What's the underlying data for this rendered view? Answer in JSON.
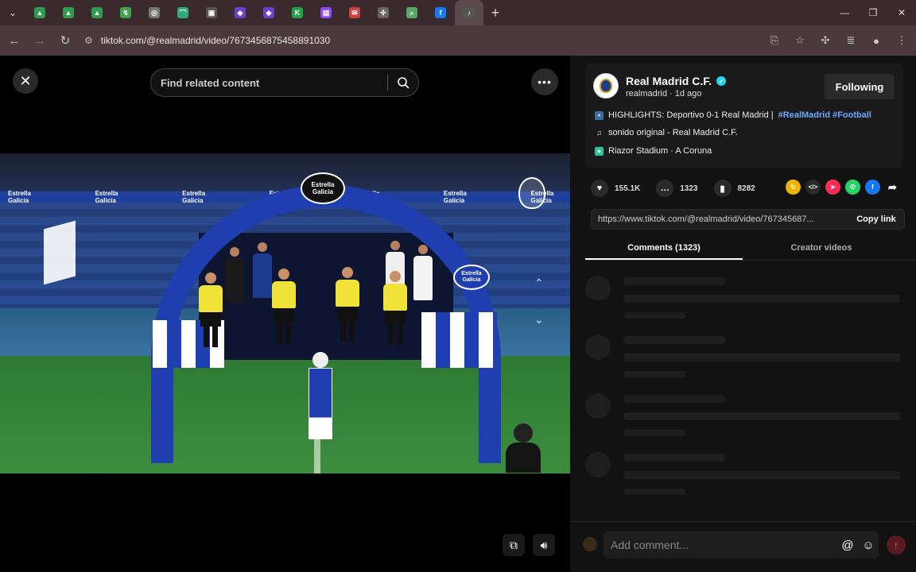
{
  "browser": {
    "url": "tiktok.com/@realmadrid/video/7673456875458891030",
    "tabs": [
      {
        "icon": "drive-icon",
        "color": "#2e9d4f",
        "glyph": "▲"
      },
      {
        "icon": "drive-icon",
        "color": "#2e9d4f",
        "glyph": "▲"
      },
      {
        "icon": "drive-icon",
        "color": "#2e9d4f",
        "glyph": "▲"
      },
      {
        "icon": "extension-icon",
        "color": "#3fa34d",
        "glyph": "↯"
      },
      {
        "icon": "globe-icon",
        "color": "#777",
        "glyph": "◎"
      },
      {
        "icon": "app-icon",
        "color": "#3a7",
        "glyph": "⌒"
      },
      {
        "icon": "window-icon",
        "color": "#555",
        "glyph": "▣"
      },
      {
        "icon": "app-icon",
        "color": "#6b3fd0",
        "glyph": "◆"
      },
      {
        "icon": "app-icon",
        "color": "#6b3fd0",
        "glyph": "◆"
      },
      {
        "icon": "k-icon",
        "color": "#1fa34a",
        "glyph": "K"
      },
      {
        "icon": "twitch-icon",
        "color": "#9146ff",
        "glyph": "▤"
      },
      {
        "icon": "mail-icon",
        "color": "#d04040",
        "glyph": "✉"
      },
      {
        "icon": "puzzle-icon",
        "color": "#666",
        "glyph": "✣"
      },
      {
        "icon": "search-icon",
        "color": "#5a6",
        "glyph": "⌕"
      },
      {
        "icon": "facebook-icon",
        "color": "#1877f2",
        "glyph": "f"
      },
      {
        "icon": "audio-icon",
        "color": "#555",
        "glyph": "♪"
      }
    ]
  },
  "video": {
    "search_placeholder": "Find related content",
    "banner_text": "Estrella Galicia",
    "arch_logo": "Estrella Galicia"
  },
  "author": {
    "name": "Real Madrid C.F.",
    "sub": "realmadrid · 1d ago",
    "follow_label": "Following",
    "desc_prefix": "HIGHLIGHTS: Deportivo 0-1 Real Madrid |",
    "tag1": "#RealMadrid",
    "tag2": "#Football",
    "sound": "sonido original - Real Madrid C.F.",
    "location": "Riazor Stadium · A Coruna"
  },
  "stats": {
    "likes": "155.1K",
    "comments": "1323",
    "saves": "8282"
  },
  "link": {
    "url": "https://www.tiktok.com/@realmadrid/video/767345687...",
    "copy_label": "Copy link"
  },
  "tabs": {
    "comments": "Comments (1323)",
    "creator": "Creator videos"
  },
  "comment_bar": {
    "placeholder": "Add comment..."
  }
}
